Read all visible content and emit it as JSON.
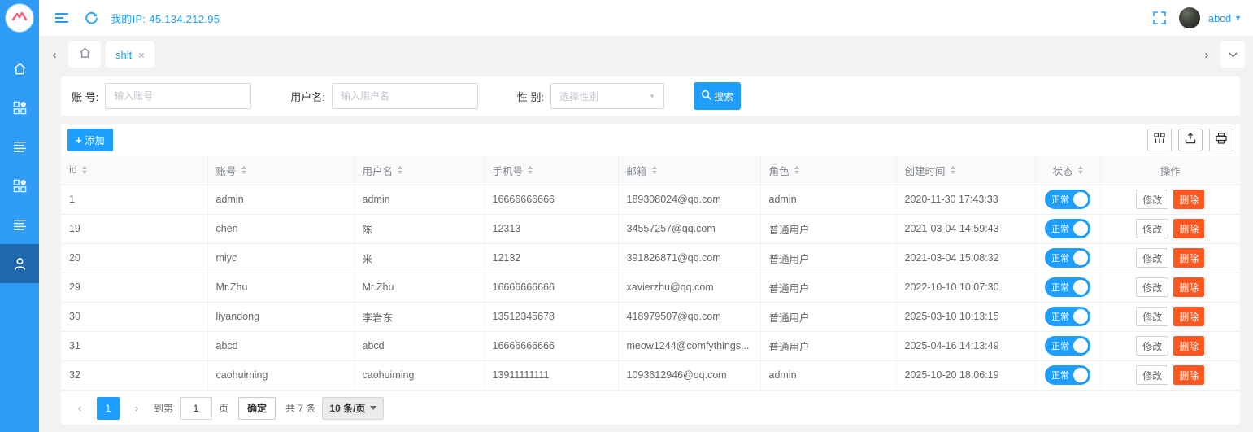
{
  "topbar": {
    "ip_text": "我的IP: 45.134.212.95",
    "username": "abcd"
  },
  "tabbar": {
    "tab_label": "shit",
    "close_glyph": "×"
  },
  "search": {
    "account_label": "账 号:",
    "account_placeholder": "输入账号",
    "username_label": "用户名:",
    "username_placeholder": "输入用户名",
    "gender_label": "性 别:",
    "gender_placeholder": "选择性别",
    "search_label": "搜索"
  },
  "toolbar": {
    "add_label": "添加",
    "icons": [
      "filter-columns-icon",
      "export-icon",
      "print-icon"
    ]
  },
  "table": {
    "columns": [
      {
        "key": "id",
        "label": "id",
        "sortable": true
      },
      {
        "key": "account",
        "label": "账号",
        "sortable": true
      },
      {
        "key": "username",
        "label": "用户名",
        "sortable": true
      },
      {
        "key": "phone",
        "label": "手机号",
        "sortable": true
      },
      {
        "key": "email",
        "label": "邮箱",
        "sortable": true
      },
      {
        "key": "role",
        "label": "角色",
        "sortable": true
      },
      {
        "key": "created",
        "label": "创建时间",
        "sortable": true
      },
      {
        "key": "status",
        "label": "状态",
        "sortable": true
      },
      {
        "key": "actions",
        "label": "操作",
        "sortable": false
      }
    ],
    "edit_label": "修改",
    "delete_label": "删除",
    "rows": [
      {
        "id": "1",
        "account": "admin",
        "username": "admin",
        "phone": "16666666666",
        "email": "189308024@qq.com",
        "role": "admin",
        "created": "2020-11-30 17:43:33",
        "status": "正常"
      },
      {
        "id": "19",
        "account": "chen",
        "username": "陈",
        "phone": "12313",
        "email": "34557257@qq.com",
        "role": "普通用户",
        "created": "2021-03-04 14:59:43",
        "status": "正常"
      },
      {
        "id": "20",
        "account": "miyc",
        "username": "米",
        "phone": "12132",
        "email": "391826871@qq.com",
        "role": "普通用户",
        "created": "2021-03-04 15:08:32",
        "status": "正常"
      },
      {
        "id": "29",
        "account": "Mr.Zhu",
        "username": "Mr.Zhu",
        "phone": "16666666666",
        "email": "xavierzhu@qq.com",
        "role": "普通用户",
        "created": "2022-10-10 10:07:30",
        "status": "正常"
      },
      {
        "id": "30",
        "account": "liyandong",
        "username": "李岩东",
        "phone": "13512345678",
        "email": "418979507@qq.com",
        "role": "普通用户",
        "created": "2025-03-10 10:13:15",
        "status": "正常"
      },
      {
        "id": "31",
        "account": "abcd",
        "username": "abcd",
        "phone": "16666666666",
        "email": "meow1244@comfythings...",
        "role": "普通用户",
        "created": "2025-04-16 14:13:49",
        "status": "正常"
      },
      {
        "id": "32",
        "account": "caohuiming",
        "username": "caohuiming",
        "phone": "13911111111",
        "email": "1093612946@qq.com",
        "role": "admin",
        "created": "2025-10-20 18:06:19",
        "status": "正常"
      }
    ]
  },
  "pagination": {
    "current_page": "1",
    "jump_prefix": "到第",
    "jump_value": "1",
    "jump_suffix": "页",
    "confirm_label": "确定",
    "total_label": "共 7 条",
    "page_size_label": "10 条/页"
  },
  "sidebar": {
    "items": [
      {
        "name": "home",
        "icon": "home-icon",
        "active": false
      },
      {
        "name": "apps-1",
        "icon": "apps-icon",
        "active": false
      },
      {
        "name": "list-1",
        "icon": "list-icon",
        "active": false
      },
      {
        "name": "apps-2",
        "icon": "apps-icon",
        "active": false
      },
      {
        "name": "list-2",
        "icon": "list-icon",
        "active": false
      },
      {
        "name": "users",
        "icon": "user-icon",
        "active": true
      }
    ]
  },
  "colors": {
    "primary": "#1e9fff",
    "danger": "#ff5722",
    "sidebar": "#2e9bf6",
    "sidebar_active": "#1f68ae"
  }
}
